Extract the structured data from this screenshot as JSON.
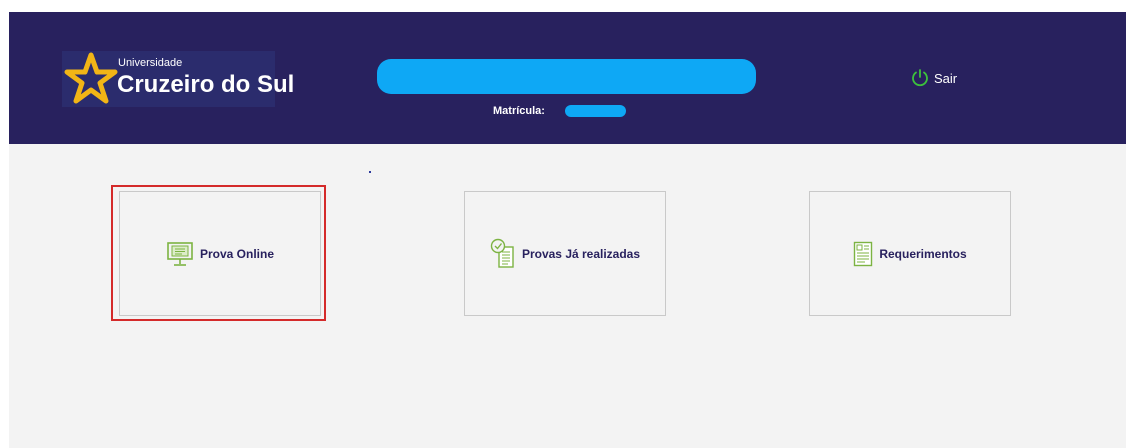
{
  "header": {
    "logo": {
      "line1": "Universidade",
      "line2": "Cruzeiro do Sul",
      "star_color": "#f2b516"
    },
    "student": {
      "matricula_label": "Matrícula:",
      "redaction_color": "#0ea8f5"
    },
    "logout": {
      "icon": "power-icon",
      "label": "Sair",
      "icon_color": "#3cc23c"
    },
    "background": "#28215e"
  },
  "cards": [
    {
      "label": "Prova Online",
      "icon": "monitor-icon",
      "highlighted": true
    },
    {
      "label": "Provas Já realizadas",
      "icon": "checked-document-icon",
      "highlighted": false
    },
    {
      "label": "Requerimentos",
      "icon": "form-document-icon",
      "highlighted": false
    }
  ],
  "colors": {
    "icon_green": "#7cb342",
    "highlight_red": "#d42a2a",
    "content_background": "#f3f3f3"
  }
}
